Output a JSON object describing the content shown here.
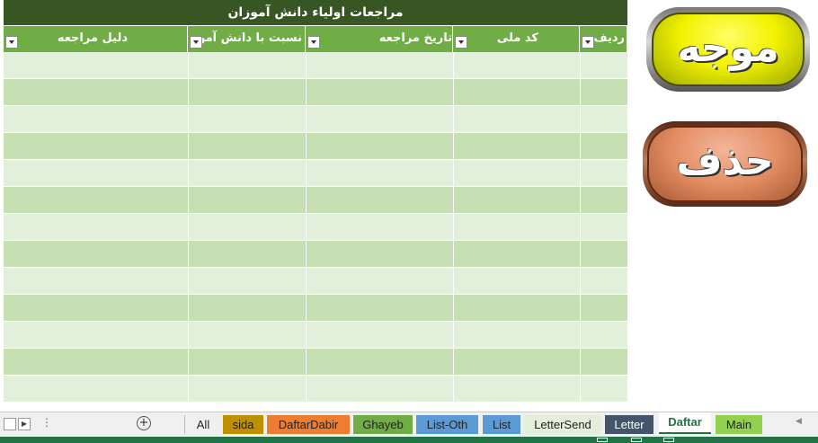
{
  "sheet": {
    "title": "مراجعات اولیاء دانش آموزان",
    "columns": [
      {
        "label": "ردیف"
      },
      {
        "label": "کد ملی"
      },
      {
        "label": "تاریخ مراجعه"
      },
      {
        "label": "نسبت با دانش آموز"
      },
      {
        "label": "دلیل مراجعه"
      }
    ],
    "row_count": 13
  },
  "buttons": {
    "movajah": "موجه",
    "delete": "حذف"
  },
  "tabbar": {
    "all_label": "All",
    "add_icon": "plus-circle-icon",
    "more_icon": "vertical-ellipsis-icon",
    "tabs": [
      {
        "label": "sida",
        "color": "#bf8f00",
        "active": false
      },
      {
        "label": "DaftarDabir",
        "color": "#ed7d31",
        "active": false
      },
      {
        "label": "Ghayeb",
        "color": "#70ad47",
        "active": false
      },
      {
        "label": "List-Oth",
        "color": "#5b9bd5",
        "active": false
      },
      {
        "label": "List",
        "color": "#5b9bd5",
        "active": false
      },
      {
        "label": "LetterSend",
        "color": "#e2efda",
        "active": false
      },
      {
        "label": "Letter",
        "color": "#44546a",
        "active": false
      },
      {
        "label": "Daftar",
        "color": "#ffffff",
        "active": true
      },
      {
        "label": "Main",
        "color": "#92d050",
        "active": false
      }
    ]
  },
  "colors": {
    "title_bg": "#375623",
    "header_bg": "#70ad47",
    "row_a": "#c6e0b4",
    "row_b": "#e2efda",
    "status_bar": "#217346"
  }
}
